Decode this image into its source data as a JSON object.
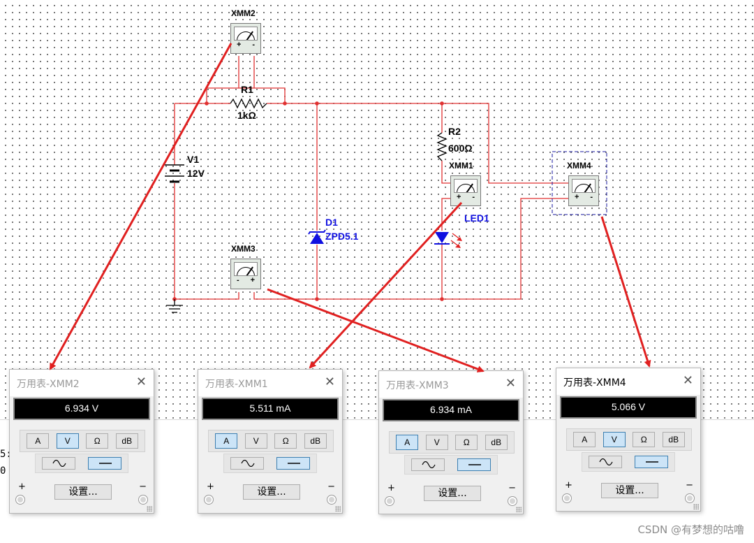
{
  "schematic": {
    "v1_name": "V1",
    "v1_value": "12V",
    "r1_name": "R1",
    "r1_value": "1kΩ",
    "r2_name": "R2",
    "r2_value": "600Ω",
    "d1_name": "D1",
    "d1_value": "ZPD5.1",
    "led_name": "LED1",
    "xmm1_label": "XMM1",
    "xmm2_label": "XMM2",
    "xmm3_label": "XMM3",
    "xmm4_label": "XMM4",
    "plus_sign": "+",
    "minus_sign": "-"
  },
  "side_fragments": [
    "5:",
    "0"
  ],
  "multimeters": [
    {
      "title": "万用表-XMM2",
      "reading": "6.934 V",
      "selected_mode": "V",
      "active": false
    },
    {
      "title": "万用表-XMM1",
      "reading": "5.511 mA",
      "selected_mode": "A",
      "active": false
    },
    {
      "title": "万用表-XMM3",
      "reading": "6.934 mA",
      "selected_mode": "A",
      "active": false
    },
    {
      "title": "万用表-XMM4",
      "reading": "5.066 V",
      "selected_mode": "V",
      "active": true
    }
  ],
  "mode_buttons": [
    "A",
    "V",
    "Ω",
    "dB"
  ],
  "settings_label": "设置...",
  "close_symbol": "✕",
  "term_plus": "+",
  "term_minus": "−",
  "watermark": "CSDN @有梦想的咕噜",
  "colors": {
    "wire": "#e03030",
    "arrow": "#e02020",
    "component_blue": "#1010e0",
    "selected_btn": "#cce4f7"
  }
}
